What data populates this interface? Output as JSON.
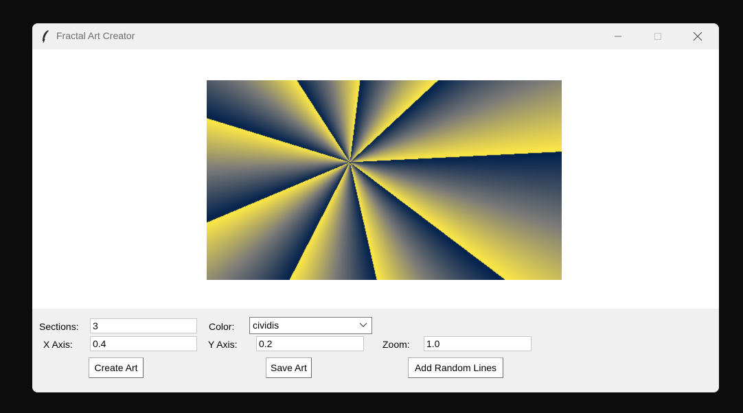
{
  "window": {
    "title": "Fractal Art Creator",
    "icon": "feather-icon"
  },
  "canvas": {
    "colormap": "cividis",
    "colors": {
      "dark": "#00204c",
      "mid": "#7c7b78",
      "light": "#ffe945"
    }
  },
  "controls": {
    "sections_label": "Sections:",
    "sections_value": "3",
    "color_label": "Color:",
    "color_value": "cividis",
    "x_axis_label": "X Axis:",
    "x_axis_value": "0.4",
    "y_axis_label": "Y Axis:",
    "y_axis_value": "0.2",
    "zoom_label": "Zoom:",
    "zoom_value": "1.0",
    "create_button": "Create Art",
    "save_button": "Save Art",
    "random_lines_button": "Add Random Lines"
  }
}
